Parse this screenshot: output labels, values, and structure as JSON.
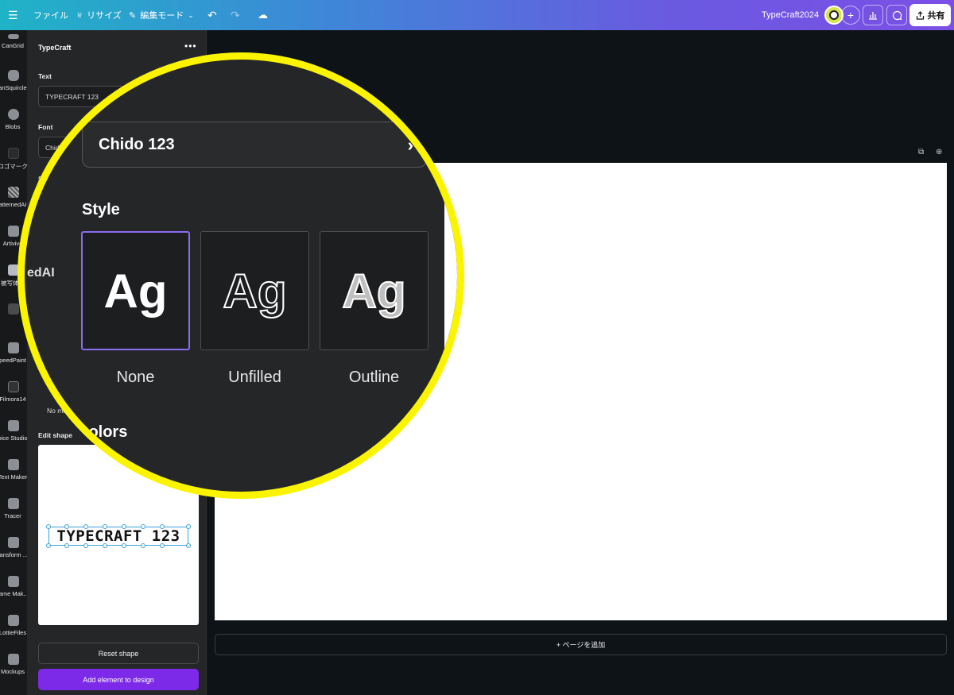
{
  "topbar": {
    "file": "ファイル",
    "resize": "リサイズ",
    "edit_mode": "編集モード",
    "project_name": "TypeCraft2024",
    "share": "共有"
  },
  "rail": {
    "items": [
      {
        "label": "CanGrid"
      },
      {
        "label": "anSquircle"
      },
      {
        "label": "Blobs"
      },
      {
        "label": "ロゴマーク"
      },
      {
        "label": "atternedAI"
      },
      {
        "label": "Artivive"
      },
      {
        "label": "被写体化"
      },
      {
        "label": ""
      },
      {
        "label": "peedPaint"
      },
      {
        "label": "Filmora14"
      },
      {
        "label": "oice Studio"
      },
      {
        "label": "Text Maker"
      },
      {
        "label": "Tracer"
      },
      {
        "label": "ransform ..."
      },
      {
        "label": "rame Mak..."
      },
      {
        "label": "LottieFiles"
      },
      {
        "label": "Mockups"
      }
    ]
  },
  "panel": {
    "title": "TypeCraft",
    "text_label": "Text",
    "text_value": "TYPECRAFT 123",
    "font_label": "Font",
    "font_value_partial": "Chid",
    "style_partial": "St",
    "no_mirror_partial": "No mi",
    "edit_shape_label": "Edit shape",
    "shape_preview_text": "TYPECRAFT 123",
    "reset_shape": "Reset shape",
    "add_element": "Add element to design"
  },
  "canvas": {
    "add_page": "+ ページを追加"
  },
  "magnifier": {
    "rail_fragment": "edAI",
    "font_value": "Chido 123",
    "style_heading": "Style",
    "colors_heading": "Colors",
    "styles": [
      {
        "glyph": "Ag",
        "label": "None",
        "selected": true
      },
      {
        "glyph": "Ag",
        "label": "Unfilled",
        "selected": false
      },
      {
        "glyph": "Ag",
        "label": "Outline",
        "selected": false
      }
    ]
  },
  "colors": {
    "accent": "#7d2ae8",
    "highlight": "#fbf400",
    "selection": "#8a6cf0"
  }
}
